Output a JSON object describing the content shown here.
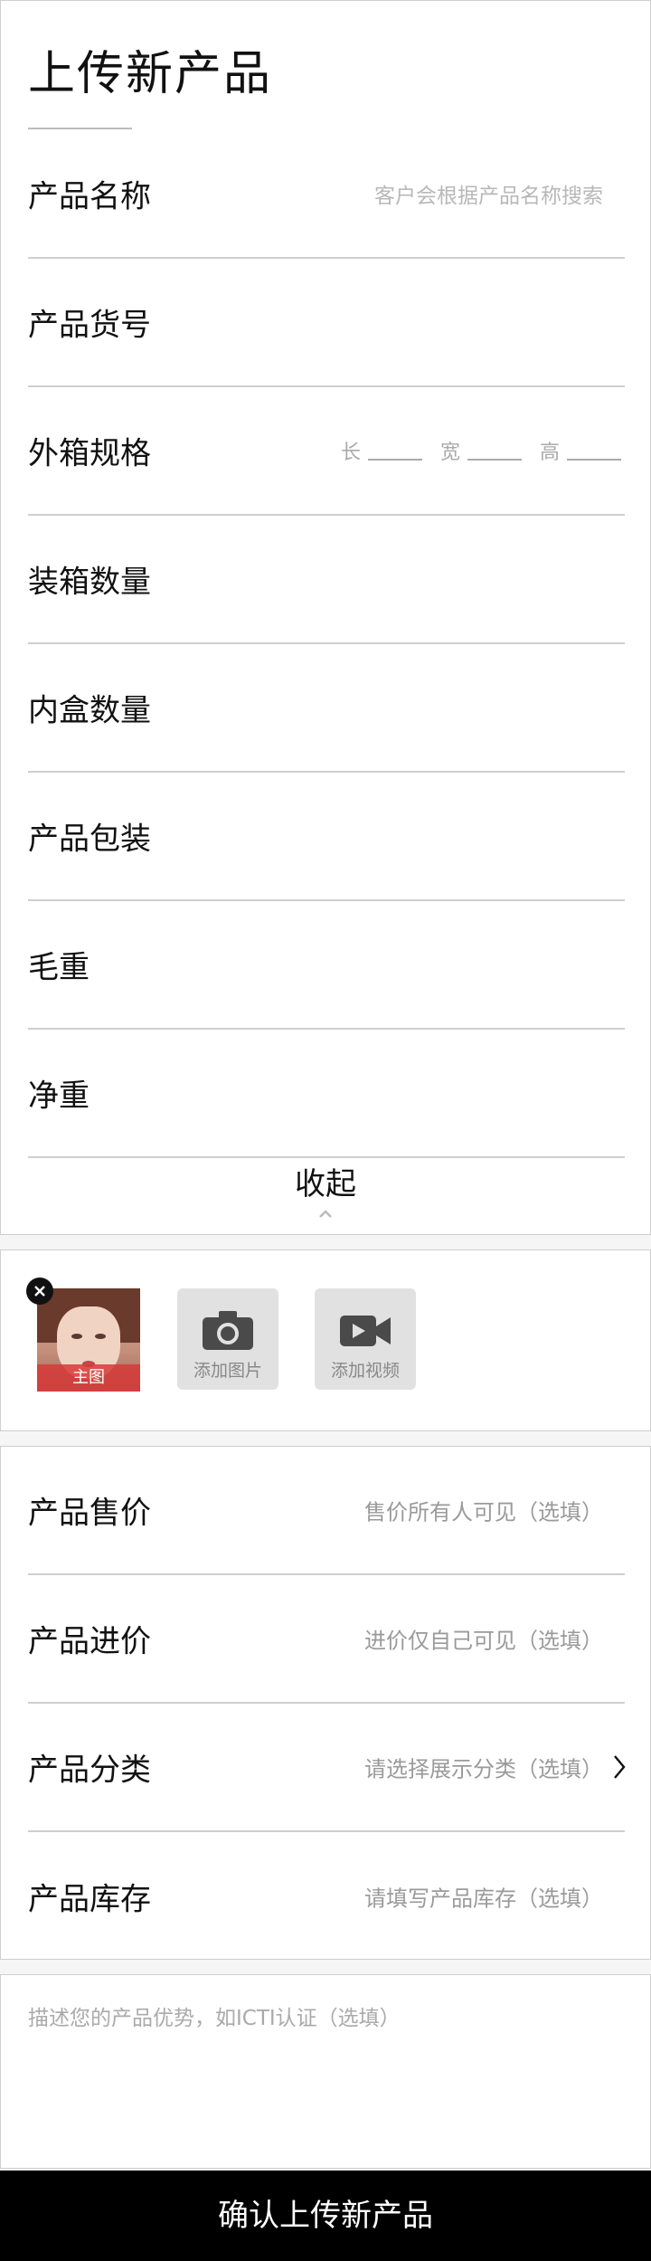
{
  "page": {
    "title": "上传新产品"
  },
  "spec_rows": [
    {
      "label": "产品名称",
      "placeholder": "客户会根据产品名称搜索"
    },
    {
      "label": "产品货号",
      "placeholder": ""
    },
    {
      "label": "外箱规格",
      "placeholder": ""
    },
    {
      "label": "装箱数量",
      "placeholder": ""
    },
    {
      "label": "内盒数量",
      "placeholder": ""
    },
    {
      "label": "产品包装",
      "placeholder": ""
    },
    {
      "label": "毛重",
      "placeholder": ""
    },
    {
      "label": "净重",
      "placeholder": ""
    }
  ],
  "dimensions": {
    "length": "长",
    "width": "宽",
    "height": "高"
  },
  "collapse": {
    "label": "收起"
  },
  "media": {
    "main_image_tag": "主图",
    "add_image_label": "添加图片",
    "add_video_label": "添加视频"
  },
  "price_rows": [
    {
      "label": "产品售价",
      "placeholder": "售价所有人可见（选填）"
    },
    {
      "label": "产品进价",
      "placeholder": "进价仅自己可见（选填）"
    },
    {
      "label": "产品分类",
      "placeholder": "请选择展示分类（选填）"
    },
    {
      "label": "产品库存",
      "placeholder": "请填写产品库存（选填）"
    }
  ],
  "description": {
    "placeholder": "描述您的产品优势，如ICTI认证（选填）"
  },
  "submit": {
    "label": "确认上传新产品"
  }
}
